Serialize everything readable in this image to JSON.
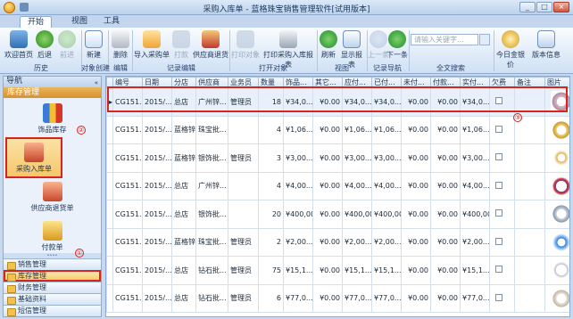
{
  "window": {
    "title": "采购入库单 - 蓝格珠宝销售管理软件[试用版本]",
    "controls": [
      "_",
      "□",
      "×"
    ]
  },
  "tabs": [
    {
      "label": "开始",
      "active": true
    },
    {
      "label": "视图",
      "active": false
    },
    {
      "label": "工具",
      "active": false
    }
  ],
  "ribbon": {
    "buttons": [
      {
        "label": "欢迎首页",
        "icon": "home-icon",
        "disabled": false
      },
      {
        "label": "后退",
        "icon": "back-icon",
        "disabled": false
      },
      {
        "label": "前进",
        "icon": "forward-icon",
        "disabled": true
      },
      {
        "label": "新建",
        "icon": "new-doc-icon",
        "disabled": false
      },
      {
        "label": "删除",
        "icon": "delete-icon",
        "disabled": false
      },
      {
        "label": "导入采购单",
        "icon": "import-icon",
        "disabled": false
      },
      {
        "label": "打款",
        "icon": "payment-icon",
        "disabled": true
      },
      {
        "label": "供应商退货",
        "icon": "return-icon",
        "disabled": false
      },
      {
        "label": "打印对象",
        "icon": "print-object-icon",
        "disabled": true
      },
      {
        "label": "打印采购入库报表",
        "icon": "printer-icon",
        "disabled": false
      },
      {
        "label": "刷新",
        "icon": "refresh-icon",
        "disabled": false
      },
      {
        "label": "显示报表",
        "icon": "report-icon",
        "disabled": false
      },
      {
        "label": "上一条",
        "icon": "up-icon",
        "disabled": true
      },
      {
        "label": "下一条",
        "icon": "down-icon",
        "disabled": false
      },
      {
        "label": "今日金银价",
        "icon": "gold-price-icon",
        "disabled": false
      },
      {
        "label": "版本信息",
        "icon": "info-icon",
        "disabled": false
      }
    ],
    "groups": [
      "历史",
      "对象创建",
      "编辑",
      "记录编辑",
      "打开对象",
      "视图",
      "记录导航",
      "全文搜索"
    ],
    "search": {
      "placeholder": "请输入关键字..."
    }
  },
  "nav": {
    "title": "导航",
    "section": "库存管理",
    "tiles": [
      {
        "label": "饰品库存",
        "icon": "inventory-chart-icon",
        "active": false
      },
      {
        "label": "采购入库单",
        "icon": "purchase-in-icon",
        "active": true
      },
      {
        "label": "供应商退货单",
        "icon": "supplier-return-icon",
        "active": false
      },
      {
        "label": "付款单",
        "icon": "payment-slip-icon",
        "active": false
      }
    ],
    "menu": [
      {
        "label": "销售管理",
        "active": false
      },
      {
        "label": "库存管理",
        "active": true
      },
      {
        "label": "财务管理",
        "active": false
      },
      {
        "label": "基础资料",
        "active": false
      },
      {
        "label": "短信管理",
        "active": false
      }
    ],
    "annotations": [
      "①",
      "②"
    ]
  },
  "grid": {
    "annotation": "③",
    "columns": [
      "编号",
      "日期",
      "分店",
      "供应商",
      "业务员",
      "数量",
      "饰品...",
      "其它...",
      "应付...",
      "已付...",
      "未付...",
      "付款...",
      "实付...",
      "欠费",
      "备注",
      "图片"
    ],
    "rows": [
      {
        "id": "CG151...",
        "date": "2015/...",
        "store": "总店",
        "supplier": "广州锌...",
        "clerk": "管理员",
        "qty": "18",
        "item": "¥34,0...",
        "other": "¥0.00",
        "payable": "¥34,0...",
        "paid": "¥34,0...",
        "unpaid": "¥0.00",
        "payment": "¥0.00",
        "actual": "¥34,0...",
        "thumb": "bracelet-icon",
        "selected": true
      },
      {
        "id": "CG151...",
        "date": "2015/...",
        "store": "蓝格锌...",
        "supplier": "珠宝批...",
        "clerk": "",
        "qty": "4",
        "item": "¥1,06...",
        "other": "¥0.00",
        "payable": "¥1,06...",
        "paid": "¥1,06...",
        "unpaid": "¥0.00",
        "payment": "¥0.00",
        "actual": "¥1,06...",
        "thumb": "ring-icon",
        "selected": false
      },
      {
        "id": "CG151...",
        "date": "2015/...",
        "store": "蓝格锌...",
        "supplier": "银饰批...",
        "clerk": "管理员",
        "qty": "3",
        "item": "¥3,00...",
        "other": "¥0.00",
        "payable": "¥3,00...",
        "paid": "¥3,00...",
        "unpaid": "¥0.00",
        "payment": "¥0.00",
        "actual": "¥3,00...",
        "thumb": "pendant-icon",
        "selected": false
      },
      {
        "id": "CG151...",
        "date": "2015/...",
        "store": "总店",
        "supplier": "广州锌...",
        "clerk": "",
        "qty": "4",
        "item": "¥4,00...",
        "other": "¥0.00",
        "payable": "¥4,00...",
        "paid": "¥4,00...",
        "unpaid": "¥0.00",
        "payment": "¥0.00",
        "actual": "¥4,00...",
        "thumb": "beads-icon",
        "selected": false
      },
      {
        "id": "CG151...",
        "date": "2015/...",
        "store": "总店",
        "supplier": "银饰批...",
        "clerk": "",
        "qty": "20",
        "item": "¥400,00",
        "other": "¥0.00",
        "payable": "¥400,00",
        "paid": "¥400,00",
        "unpaid": "¥0.00",
        "payment": "¥0.00",
        "actual": "¥400,00",
        "thumb": "diamond-ring-icon",
        "selected": false
      },
      {
        "id": "CG151...",
        "date": "2015/...",
        "store": "蓝格锌...",
        "supplier": "珠宝批...",
        "clerk": "管理员",
        "qty": "2",
        "item": "¥2,00...",
        "other": "¥0.00",
        "payable": "¥2,00...",
        "paid": "¥2,00...",
        "unpaid": "¥0.00",
        "payment": "¥0.00",
        "actual": "¥2,00...",
        "thumb": "blue-ring-icon",
        "selected": false
      },
      {
        "id": "CG151...",
        "date": "2015/...",
        "store": "总店",
        "supplier": "钻石批...",
        "clerk": "管理员",
        "qty": "75",
        "item": "¥15,1...",
        "other": "¥0.00",
        "payable": "¥15,1...",
        "paid": "¥15,1...",
        "unpaid": "¥0.00",
        "payment": "¥0.00",
        "actual": "¥15,1...",
        "thumb": "necklace-icon",
        "selected": false
      },
      {
        "id": "CG151...",
        "date": "2015/...",
        "store": "总店",
        "supplier": "钻石批...",
        "clerk": "管理员",
        "qty": "6",
        "item": "¥77,0...",
        "other": "¥0.00",
        "payable": "¥77,0...",
        "paid": "¥77,0...",
        "unpaid": "¥0.00",
        "payment": "¥0.00",
        "actual": "¥77,0...",
        "thumb": "pearl-necklace-icon",
        "selected": false
      }
    ]
  },
  "colors": {
    "accent": "#d9241c",
    "ribbon": "#dbe8f7",
    "nav_section": "#d7922b",
    "selected_row": "#e7f0fb"
  }
}
